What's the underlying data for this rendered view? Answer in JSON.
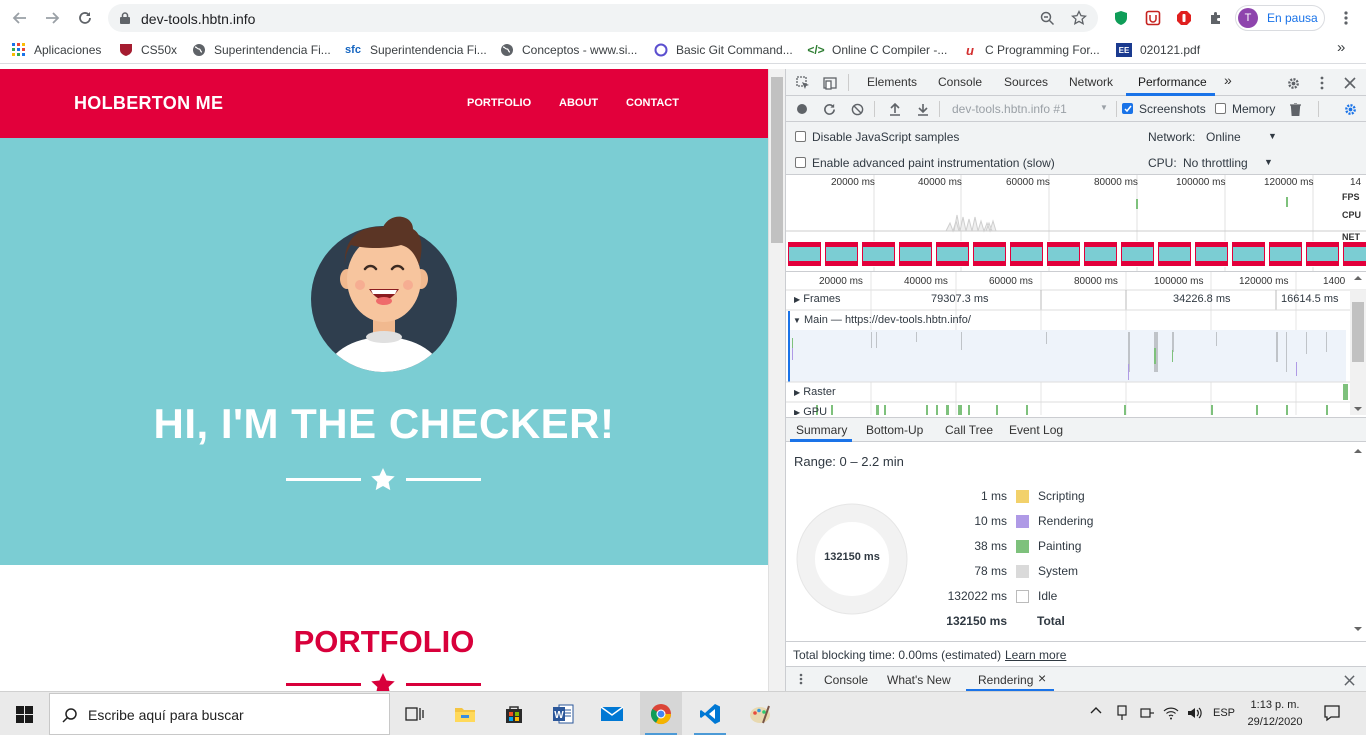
{
  "browser": {
    "url": "dev-tools.hbtn.info",
    "profile_initial": "T",
    "profile_status": "En pausa",
    "bookmarks": [
      {
        "label": "Aplicaciones"
      },
      {
        "label": "CS50x"
      },
      {
        "label": "Superintendencia Fi..."
      },
      {
        "label": "Superintendencia Fi..."
      },
      {
        "label": "Conceptos - www.si..."
      },
      {
        "label": "Basic Git Command..."
      },
      {
        "label": "Online C Compiler -..."
      },
      {
        "label": "C Programming For..."
      },
      {
        "label": "020121.pdf"
      }
    ],
    "more_bookmarks": "»"
  },
  "site": {
    "brand": "HOLBERTON ME",
    "nav": [
      "PORTFOLIO",
      "ABOUT",
      "CONTACT"
    ],
    "hero_title": "HI, I'M THE CHECKER!",
    "section_title": "PORTFOLIO"
  },
  "devtools": {
    "tabs": [
      "Elements",
      "Console",
      "Sources",
      "Network",
      "Performance"
    ],
    "active_tab": "Performance",
    "more_tabs": "»",
    "recording_label": "dev-tools.hbtn.info #1",
    "screenshots_label": "Screenshots",
    "memory_label": "Memory",
    "disable_js_samples": "Disable JavaScript samples",
    "advanced_paint": "Enable advanced paint instrumentation (slow)",
    "network_label": "Network:",
    "network_value": "Online",
    "cpu_label": "CPU:",
    "cpu_value": "No throttling",
    "overview_ticks": [
      "20000 ms",
      "40000 ms",
      "60000 ms",
      "80000 ms",
      "100000 ms",
      "120000 ms",
      "14"
    ],
    "overview_side": [
      "FPS",
      "CPU",
      "NET"
    ],
    "timeline_ticks": [
      "20000 ms",
      "40000 ms",
      "60000 ms",
      "80000 ms",
      "100000 ms",
      "120000 ms",
      "1400"
    ],
    "tracks": {
      "frames_label": "Frames",
      "frames_values": [
        "79307.3 ms",
        "34226.8 ms",
        "16614.5 ms"
      ],
      "main_label": "Main — https://dev-tools.hbtn.info/",
      "raster_label": "Raster",
      "gpu_label": "GPU"
    },
    "bottom_tabs": [
      "Summary",
      "Bottom-Up",
      "Call Tree",
      "Event Log"
    ],
    "range": "Range: 0 – 2.2 min",
    "donut_total": "132150 ms",
    "summary": [
      {
        "value": "1 ms",
        "label": "Scripting",
        "color": "#f2d16b"
      },
      {
        "value": "10 ms",
        "label": "Rendering",
        "color": "#af9ae6"
      },
      {
        "value": "38 ms",
        "label": "Painting",
        "color": "#7ec17c"
      },
      {
        "value": "78 ms",
        "label": "System",
        "color": "#dadada"
      },
      {
        "value": "132022 ms",
        "label": "Idle",
        "color": "#ffffff"
      }
    ],
    "summary_total_value": "132150 ms",
    "summary_total_label": "Total",
    "blocking_text": "Total blocking time: 0.00ms (estimated)",
    "learn_more": "Learn more",
    "drawer_tabs": [
      "Console",
      "What's New",
      "Rendering"
    ],
    "drawer_close": "×"
  },
  "taskbar": {
    "search_placeholder": "Escribe aquí para buscar",
    "lang": "ESP",
    "time": "1:13 p. m.",
    "date": "29/12/2020"
  },
  "colors": {
    "brand_red": "#e2003b",
    "hero_teal": "#7bcdd3",
    "devtools_blue": "#1a73e8"
  }
}
